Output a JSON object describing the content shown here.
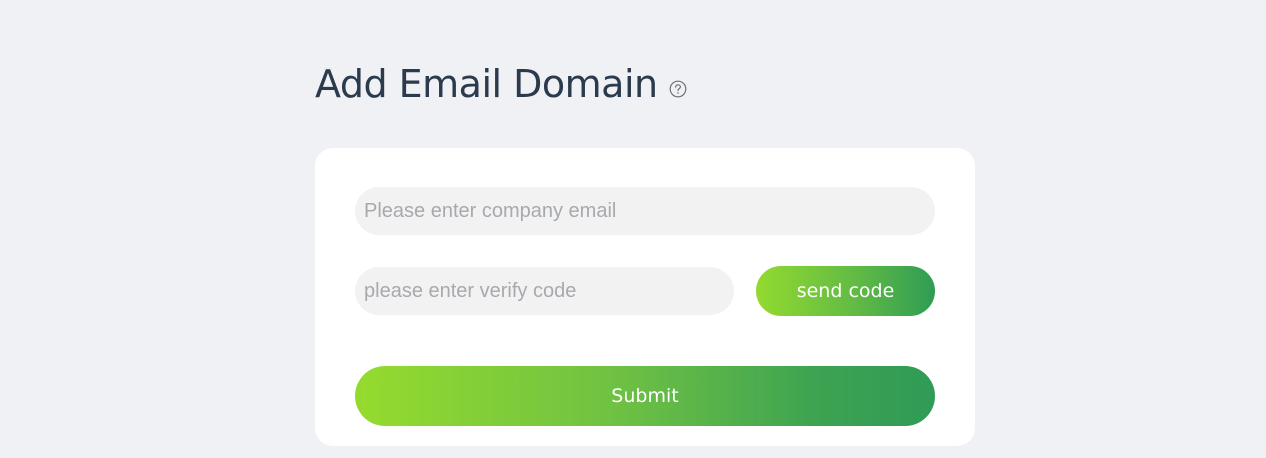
{
  "header": {
    "title": "Add Email Domain",
    "help_icon": "question-circle-icon"
  },
  "form": {
    "email_placeholder": "Please enter company email",
    "email_value": "",
    "code_placeholder": "please enter verify code",
    "code_value": "",
    "send_code_label": "send code",
    "submit_label": "Submit"
  },
  "colors": {
    "background": "#f0f1f4",
    "card": "#ffffff",
    "title": "#2c3a4d",
    "input_bg": "#f2f2f2",
    "gradient_start": "#93da2f",
    "gradient_end": "#2f9c55"
  }
}
